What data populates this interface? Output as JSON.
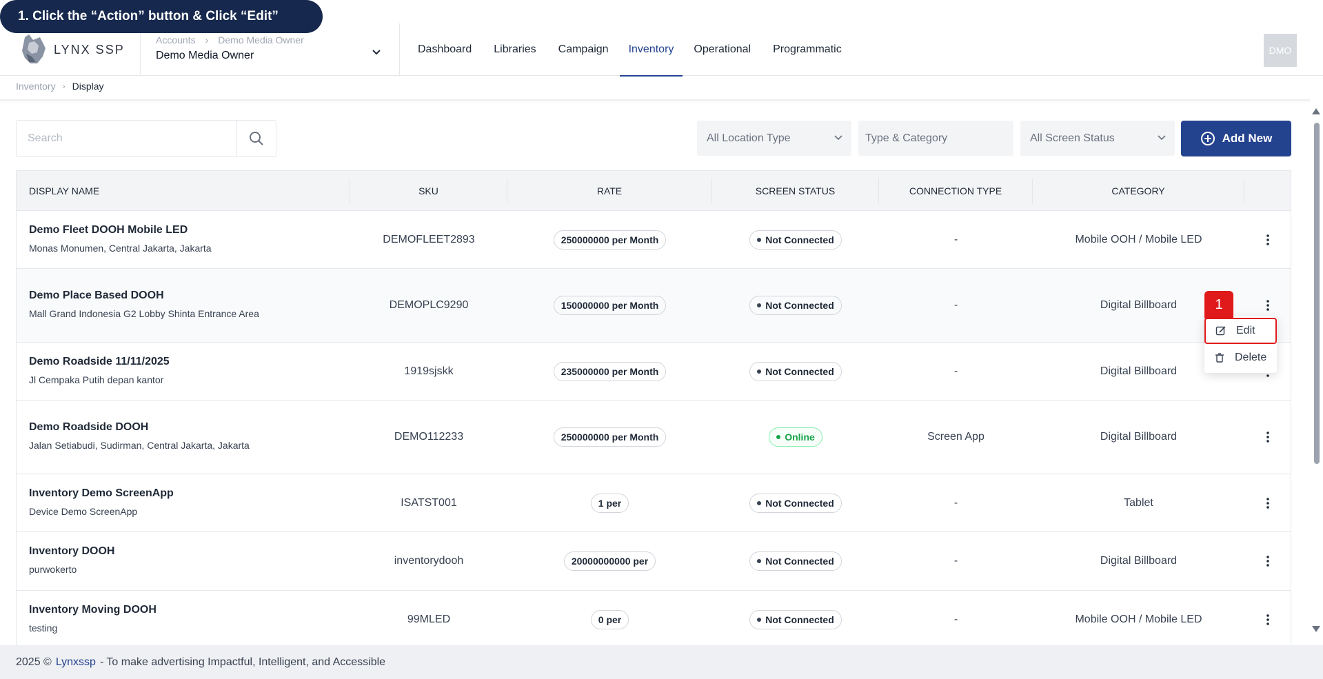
{
  "tutorial": {
    "text": "1. Click the “Action” button & Click “Edit”"
  },
  "logo": {
    "text": "LYNX SSP"
  },
  "account": {
    "crumb_parent": "Accounts",
    "crumb_child": "Demo Media Owner",
    "name": "Demo Media Owner"
  },
  "nav": {
    "items": [
      "Dashboard",
      "Libraries",
      "Campaign",
      "Inventory",
      "Operational",
      "Programmatic"
    ],
    "active": "Inventory"
  },
  "avatar": {
    "initials": "DMO"
  },
  "breadcrumb": {
    "parent": "Inventory",
    "current": "Display"
  },
  "search": {
    "placeholder": "Search"
  },
  "filters": {
    "location": "All Location Type",
    "type_category": "Type & Category",
    "screen_status": "All Screen Status"
  },
  "add_button": {
    "label": "Add New"
  },
  "table": {
    "headers": [
      "DISPLAY NAME",
      "SKU",
      "RATE",
      "SCREEN STATUS",
      "CONNECTION TYPE",
      "CATEGORY"
    ],
    "rows": [
      {
        "name": "Demo Fleet DOOH Mobile LED",
        "location": "Monas Monumen, Central Jakarta, Jakarta",
        "sku": "DEMOFLEET2893",
        "rate": "250000000 per Month",
        "status": "Not Connected",
        "connection": "-",
        "category": "Mobile OOH / Mobile LED"
      },
      {
        "name": "Demo Place Based DOOH",
        "location": "Mall Grand Indonesia G2 Lobby Shinta Entrance Area",
        "sku": "DEMOPLC9290",
        "rate": "150000000 per Month",
        "status": "Not Connected",
        "connection": "-",
        "category": "Digital Billboard"
      },
      {
        "name": "Demo Roadside 11/11/2025",
        "location": "Jl Cempaka Putih depan kantor",
        "sku": "1919sjskk",
        "rate": "235000000 per Month",
        "status": "Not Connected",
        "connection": "-",
        "category": "Digital Billboard"
      },
      {
        "name": "Demo Roadside DOOH",
        "location": "Jalan Setiabudi, Sudirman, Central Jakarta, Jakarta",
        "sku": "DEMO112233",
        "rate": "250000000 per Month",
        "status": "Online",
        "connection": "Screen App",
        "category": "Digital Billboard"
      },
      {
        "name": "Inventory Demo ScreenApp",
        "location": "Device Demo ScreenApp",
        "sku": "ISATST001",
        "rate": "1 per",
        "status": "Not Connected",
        "connection": "-",
        "category": "Tablet"
      },
      {
        "name": "Inventory DOOH",
        "location": "purwokerto",
        "sku": "inventorydooh",
        "rate": "20000000000 per",
        "status": "Not Connected",
        "connection": "-",
        "category": "Digital Billboard"
      },
      {
        "name": "Inventory Moving DOOH",
        "location": "testing",
        "sku": "99MLED",
        "rate": "0 per",
        "status": "Not Connected",
        "connection": "-",
        "category": "Mobile OOH / Mobile LED"
      }
    ]
  },
  "action_menu": {
    "step": "1",
    "edit": "Edit",
    "delete": "Delete"
  },
  "footer": {
    "year": "2025 ©",
    "brand": "Lynxssp",
    "tagline": "- To make advertising Impactful, Intelligent, and Accessible"
  },
  "colors": {
    "primary": "#24438f",
    "banner": "#16284d",
    "highlight": "#e01a1a",
    "online": "#16a34a"
  }
}
